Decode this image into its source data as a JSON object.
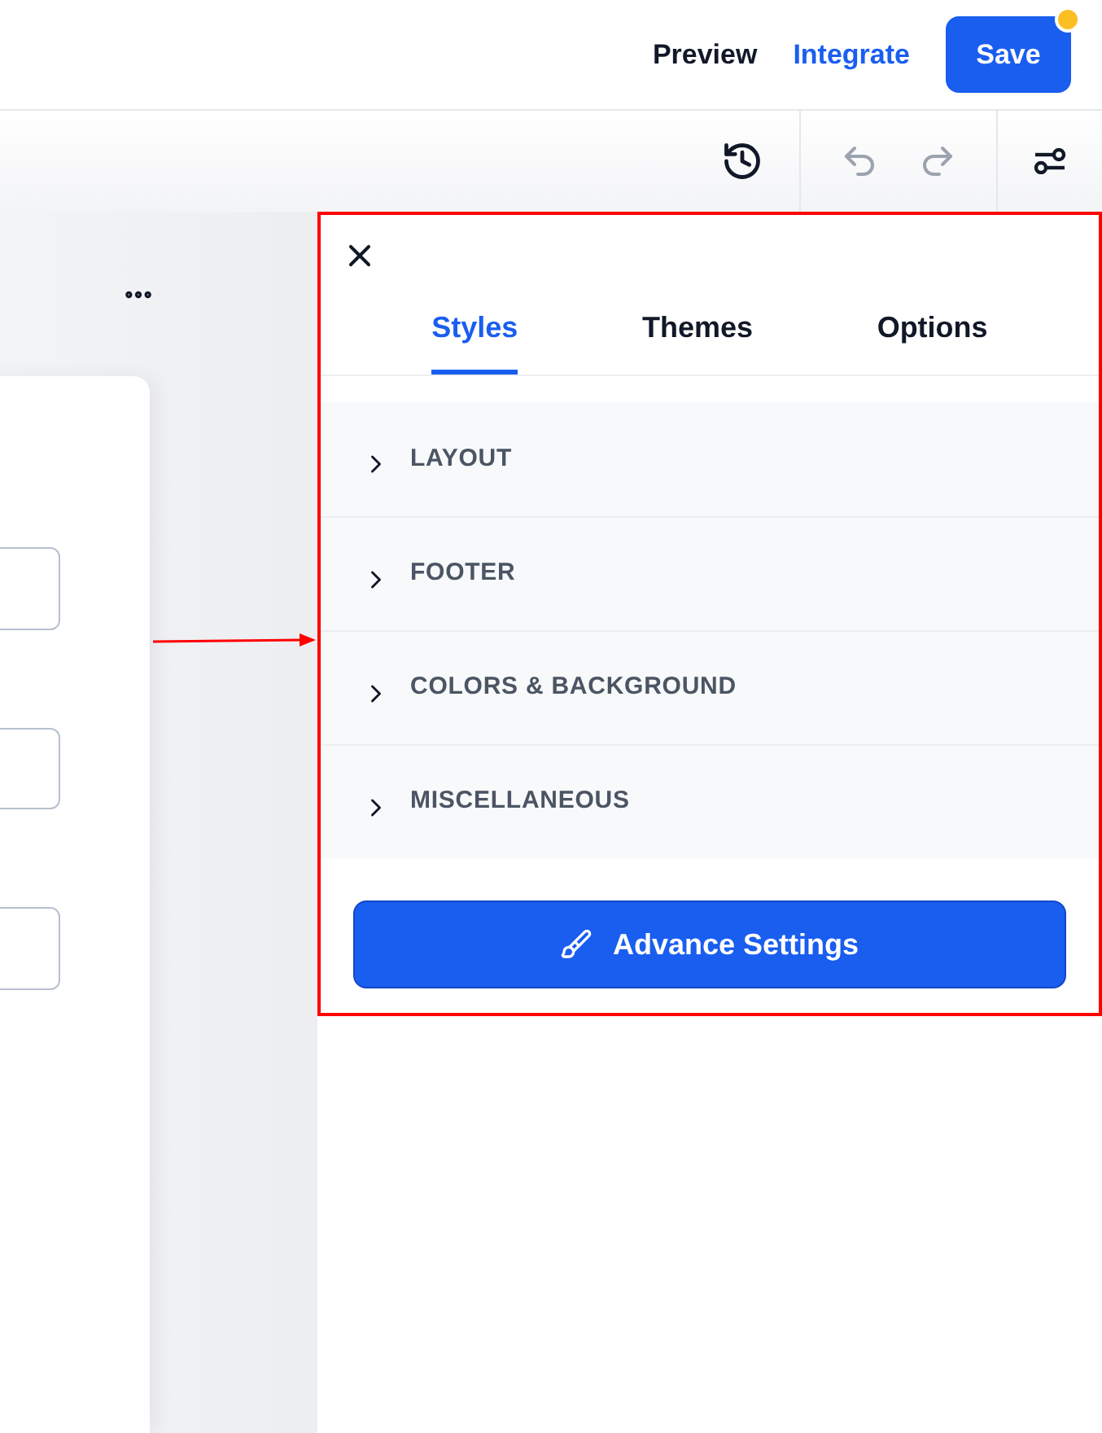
{
  "header": {
    "links": [
      {
        "label": "Preview",
        "kind": "plain"
      },
      {
        "label": "Integrate",
        "kind": "accent"
      }
    ],
    "save": {
      "label": "Save",
      "notification": true
    }
  },
  "toolbar": {
    "undo": {
      "disabled": true
    },
    "redo": {
      "disabled": true
    }
  },
  "panel": {
    "tabs": [
      {
        "label": "Styles",
        "selected": true
      },
      {
        "label": "Themes",
        "selected": false
      },
      {
        "label": "Options",
        "selected": false
      }
    ],
    "sections": [
      {
        "label": "LAYOUT",
        "expanded": false
      },
      {
        "label": "FOOTER",
        "expanded": false
      },
      {
        "label": "COLORS & BACKGROUND",
        "expanded": false
      },
      {
        "label": "MISCELLANEOUS",
        "expanded": false
      }
    ],
    "action": "Advance Settings"
  }
}
